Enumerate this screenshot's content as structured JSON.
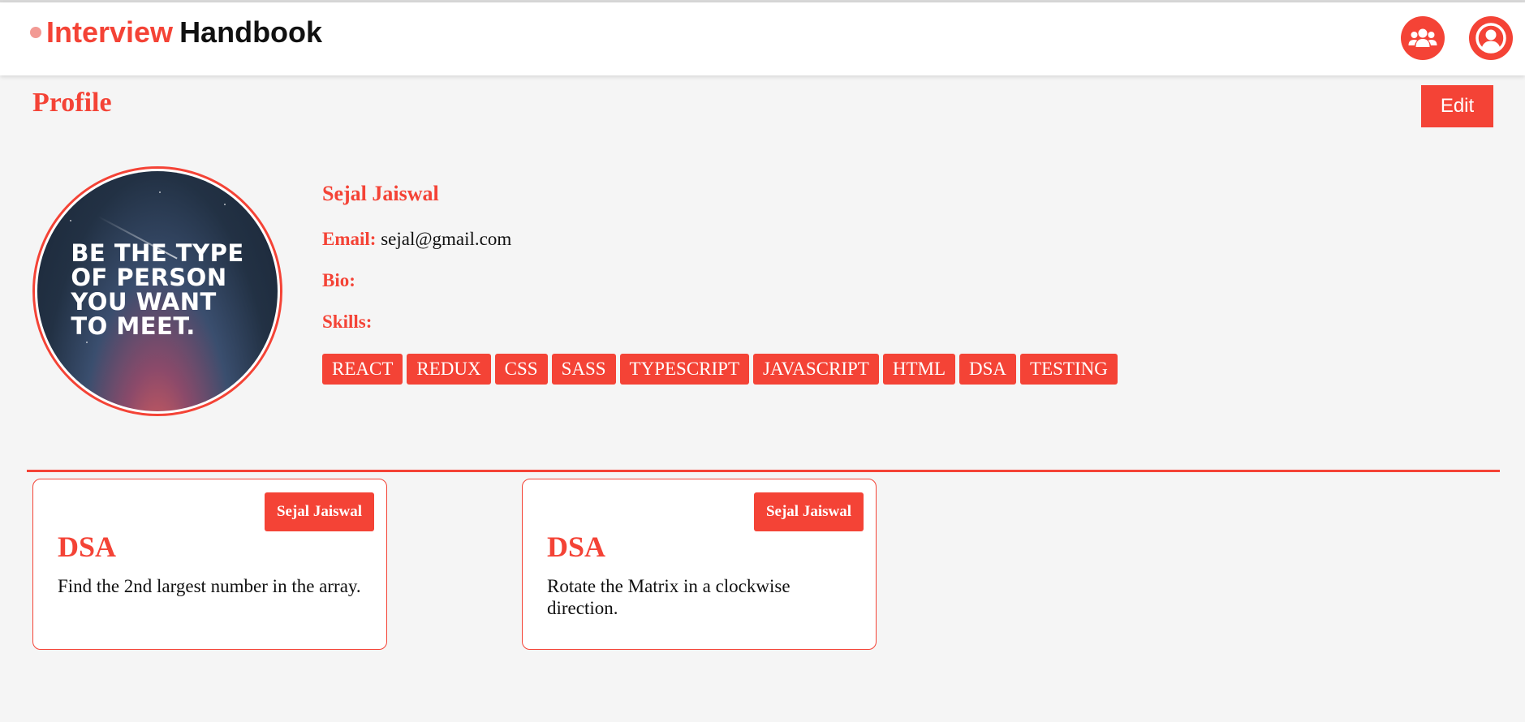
{
  "brand": {
    "primary": "Interview",
    "secondary": "Handbook"
  },
  "nav": {
    "icons": [
      "users-icon",
      "user-circle-icon"
    ]
  },
  "page": {
    "title": "Profile",
    "edit_label": "Edit"
  },
  "profile": {
    "name": "Sejal Jaiswal",
    "email_label": "Email:",
    "email": "sejal@gmail.com",
    "bio_label": "Bio:",
    "bio": "",
    "skills_label": "Skills:",
    "skills": [
      "REACT",
      "REDUX",
      "CSS",
      "SASS",
      "TYPESCRIPT",
      "JAVASCRIPT",
      "HTML",
      "DSA",
      "TESTING"
    ],
    "avatar_quote": "BE THE TYPE\nOF PERSON\nYOU WANT\nTO MEET."
  },
  "questions": [
    {
      "author": "Sejal Jaiswal",
      "category": "DSA",
      "text": "Find the 2nd largest number in the array."
    },
    {
      "author": "Sejal Jaiswal",
      "category": "DSA",
      "text": "Rotate the Matrix in a clockwise direction."
    }
  ],
  "colors": {
    "accent": "#f44336",
    "background": "#f5f5f5",
    "brand_dot": "#f29a94"
  }
}
